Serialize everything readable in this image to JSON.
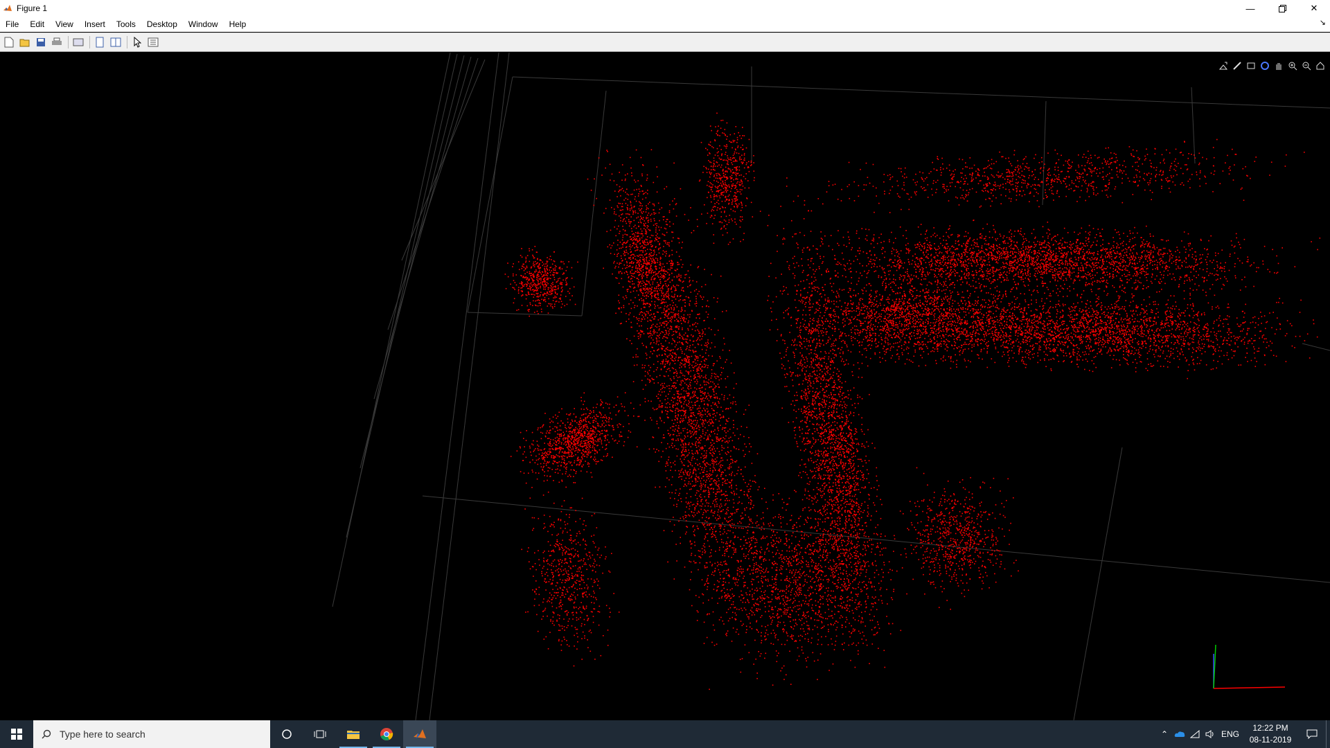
{
  "window": {
    "title": "Figure 1",
    "minimize_icon": "minimize-icon",
    "restore_icon": "restore-icon",
    "close_icon": "close-icon"
  },
  "menu": {
    "items": [
      "File",
      "Edit",
      "View",
      "Insert",
      "Tools",
      "Desktop",
      "Window",
      "Help"
    ]
  },
  "toolbar": {
    "icons": [
      "new-figure-icon",
      "open-file-icon",
      "save-icon",
      "print-icon",
      "link-plot-icon",
      "hide-plot-tools-icon",
      "show-plot-tools-icon",
      "edit-plot-icon",
      "property-inspector-icon"
    ]
  },
  "axes_toolbar": {
    "icons": [
      "export-icon",
      "brush-icon",
      "data-tips-icon",
      "rotate-3d-icon",
      "pan-icon",
      "zoom-in-icon",
      "zoom-out-icon",
      "home-icon"
    ]
  },
  "plot": {
    "type": "3d point cloud",
    "point_color": "#ff0000",
    "background": "#000000",
    "grid_color": "#3a3a3a",
    "axis_indicator": {
      "x_color": "#ff0000",
      "y_color": "#00cc00",
      "z_color": "#3a4dff"
    }
  },
  "taskbar": {
    "search_placeholder": "Type here to search",
    "apps": [
      "cortana-icon",
      "task-view-icon",
      "file-explorer-icon",
      "chrome-icon",
      "matlab-icon"
    ],
    "tray_language": "ENG",
    "time": "12:22 PM",
    "date": "08-11-2019"
  }
}
